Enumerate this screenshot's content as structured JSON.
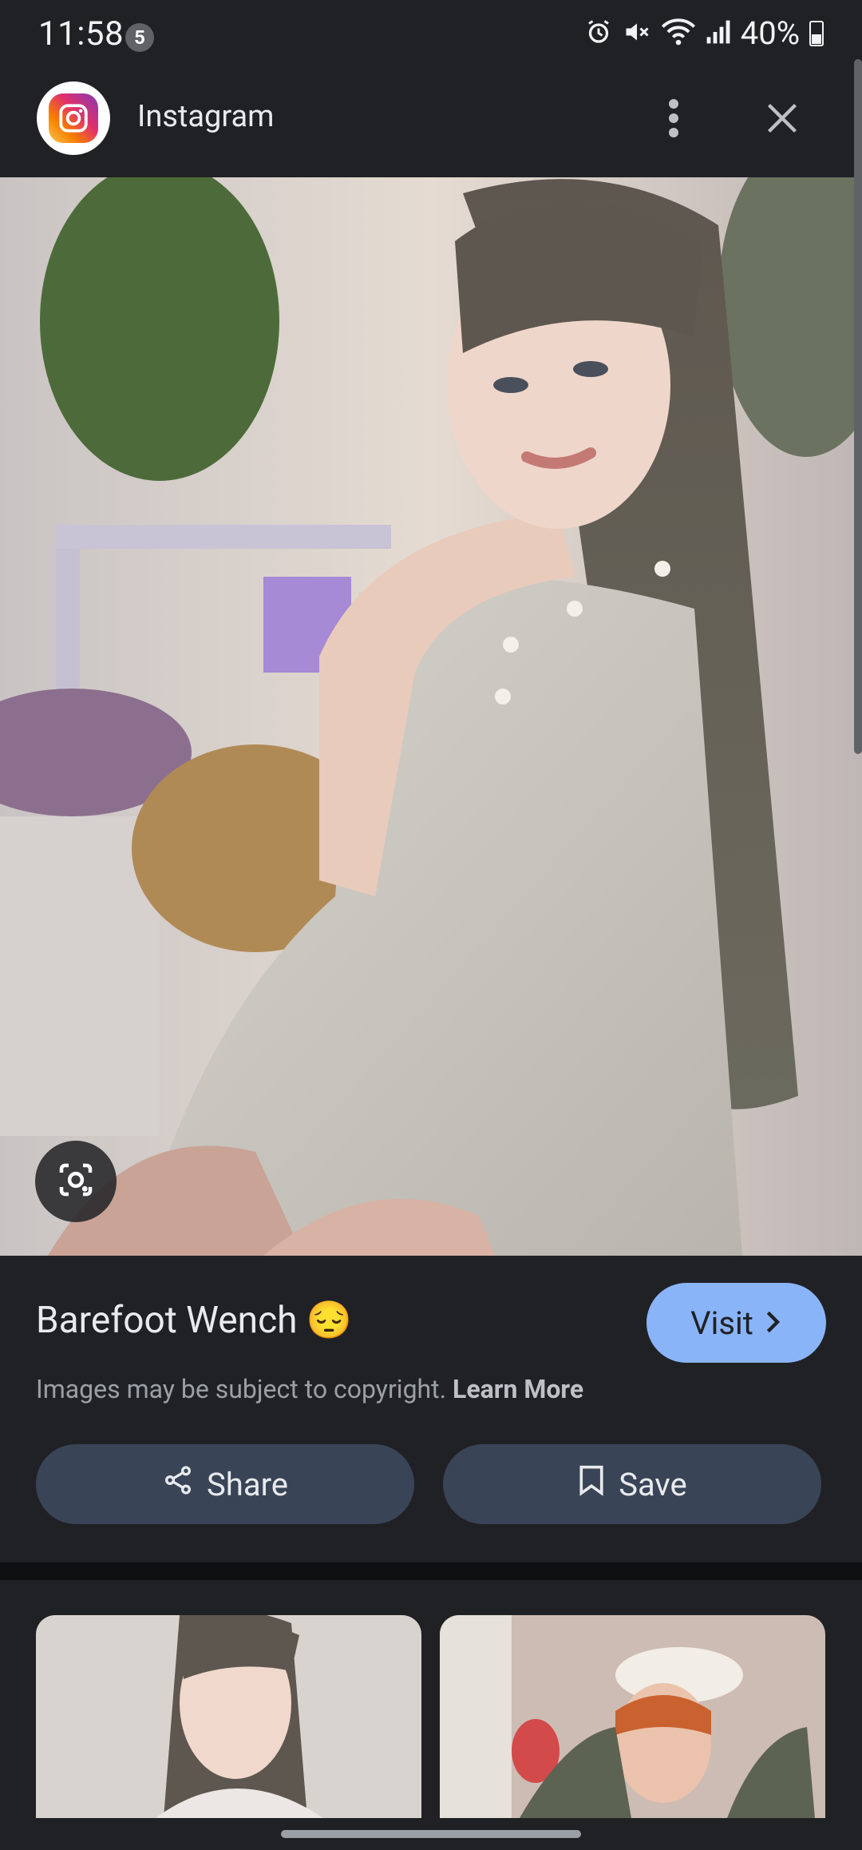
{
  "status_bar": {
    "time": "11:58",
    "notification_count": "5",
    "battery": "40%",
    "icons": [
      "alarm-icon",
      "mute-icon",
      "wifi-icon",
      "signal-icon",
      "battery-icon"
    ]
  },
  "header": {
    "app_name": "Instagram",
    "logo_icon": "instagram-logo",
    "menu_icon": "more-vert-icon",
    "close_icon": "close-icon"
  },
  "main_image": {
    "lens_icon": "google-lens-icon"
  },
  "result": {
    "title": "Barefoot Wench 😔",
    "visit_label": "Visit",
    "copyright_text": "Images may be subject to copyright.",
    "learn_more_label": "Learn More",
    "share_label": "Share",
    "save_label": "Save"
  },
  "colors": {
    "background": "#202124",
    "accent": "#8ab4f8",
    "button": "#394457",
    "secondary_text": "#9aa0a6"
  }
}
